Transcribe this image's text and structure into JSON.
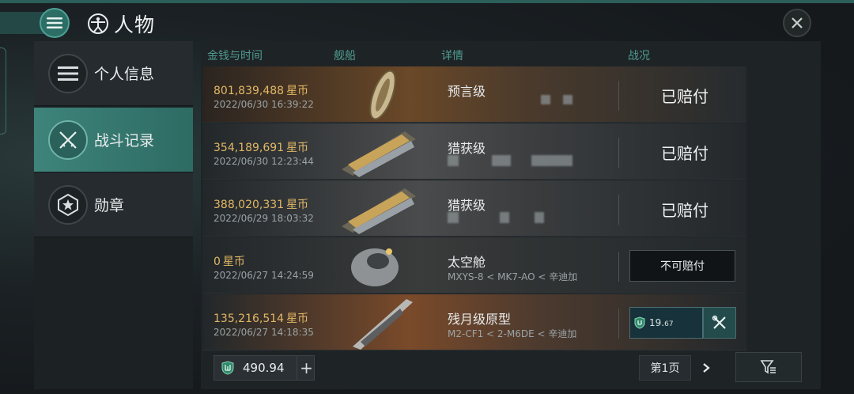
{
  "header": {
    "title": "人物",
    "title_icon": "vitruvian-icon",
    "menu_icon": "menu-icon",
    "close_icon": "close-icon"
  },
  "sidebar": {
    "items": [
      {
        "label": "个人信息",
        "icon": "list-icon",
        "active": false
      },
      {
        "label": "战斗记录",
        "icon": "crossed-swords-icon",
        "active": true
      },
      {
        "label": "勋章",
        "icon": "star-badge-icon",
        "active": false
      }
    ]
  },
  "table": {
    "headers": [
      "金钱与时间",
      "舰船",
      "详情",
      "战况"
    ],
    "rows": [
      {
        "money": "801,839,488",
        "unit": "星币",
        "date": "2022/06/30  16:39:22",
        "ship": "预言级",
        "location": "",
        "status": "已赔付"
      },
      {
        "money": "354,189,691",
        "unit": "星币",
        "date": "2022/06/30  12:23:44",
        "ship": "猎获级",
        "location": "",
        "status": "已赔付"
      },
      {
        "money": "388,020,331",
        "unit": "星币",
        "date": "2022/06/29  18:03:32",
        "ship": "猎获级",
        "location": "",
        "status": "已赔付"
      },
      {
        "money": "0",
        "unit": "星币",
        "date": "2022/06/27  14:24:59",
        "ship": "太空舱",
        "location": "MXYS-8 < MK7-AO < 辛迪加",
        "status": "不可赔付"
      },
      {
        "money": "135,216,514",
        "unit": "星币",
        "date": "2022/06/27  14:18:35",
        "ship": "残月级原型",
        "location": "M2-CF1 < 2-M6DE < 辛迪加",
        "insurance_main": "19.",
        "insurance_decimal": "67"
      }
    ]
  },
  "footer": {
    "wallet_value": "490.94",
    "add_label": "+",
    "page_label": "第1页"
  },
  "colors": {
    "accent": "#3e847b",
    "money": "#e2b865",
    "header_text": "#4f9b91"
  }
}
